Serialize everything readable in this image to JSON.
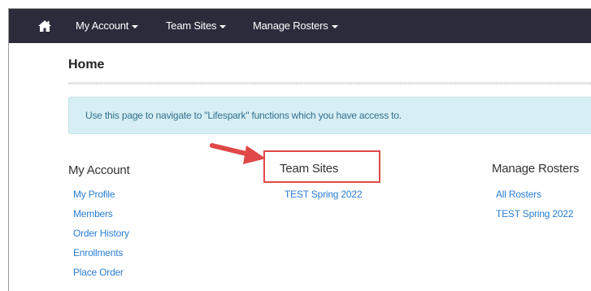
{
  "nav": {
    "home_icon": "home-icon",
    "items": [
      {
        "label": "My Account"
      },
      {
        "label": "Team Sites"
      },
      {
        "label": "Manage Rosters"
      }
    ]
  },
  "page": {
    "title": "Home",
    "info_banner": "Use this page to navigate to \"Lifespark\" functions which you have access to."
  },
  "sections": {
    "my_account": {
      "heading": "My Account",
      "links": [
        "My Profile",
        "Members",
        "Order History",
        "Enrollments",
        "Place Order"
      ]
    },
    "team_sites": {
      "heading": "Team Sites",
      "links": [
        "TEST Spring 2022"
      ]
    },
    "manage_rosters": {
      "heading": "Manage Rosters",
      "links": [
        "All Rosters",
        "TEST Spring 2022"
      ]
    }
  },
  "colors": {
    "navbar": "#2b2b3b",
    "link": "#2a7ed3",
    "banner_bg": "#d6eef4",
    "banner_text": "#31708f",
    "annotation": "#e04848"
  }
}
